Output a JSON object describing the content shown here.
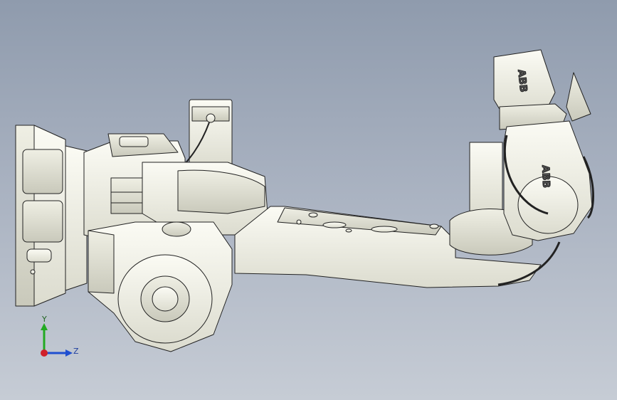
{
  "viewport": {
    "background_top": "#8f9bad",
    "background_bottom": "#c6ccd5",
    "model": {
      "brand_label_1": "ABB",
      "brand_label_2": "ABB"
    },
    "triad": {
      "y_label": "Y",
      "z_label": "Z",
      "y_color": "#22aa22",
      "z_color": "#1f4fd0",
      "x_color": "#d0202a"
    }
  }
}
